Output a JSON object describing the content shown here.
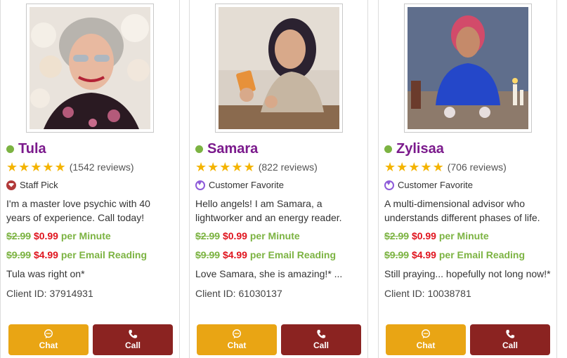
{
  "advisors": [
    {
      "name": "Tula",
      "rating": 5,
      "reviews": "(1542 reviews)",
      "badge": "Staff Pick",
      "badge_icon": "diamond-badge-icon",
      "bio": "I'm a master love psychic with 40 years of experience. Call today!",
      "minute_old": "$2.99",
      "minute_new": "$0.99",
      "minute_unit": "per Minute",
      "email_old": "$9.99",
      "email_new": "$4.99",
      "email_unit": "per Email Reading",
      "review_snippet": "Tula was right on*",
      "client_id": "Client ID: 37914931",
      "chat_label": "Chat",
      "call_label": "Call"
    },
    {
      "name": "Samara",
      "rating": 5,
      "reviews": "(822 reviews)",
      "badge": "Customer Favorite",
      "badge_icon": "heart-badge-icon",
      "bio": "Hello angels! I am Samara, a lightworker and an energy reader.",
      "minute_old": "$2.99",
      "minute_new": "$0.99",
      "minute_unit": "per Minute",
      "email_old": "$9.99",
      "email_new": "$4.99",
      "email_unit": "per Email Reading",
      "review_snippet": "Love Samara, she is amazing!* ...",
      "client_id": "Client ID: 61030137",
      "chat_label": "Chat",
      "call_label": "Call"
    },
    {
      "name": "Zylisaa",
      "rating": 5,
      "reviews": "(706 reviews)",
      "badge": "Customer Favorite",
      "badge_icon": "heart-badge-icon",
      "bio": "A multi-dimensional advisor who understands different phases of life.",
      "minute_old": "$2.99",
      "minute_new": "$0.99",
      "minute_unit": "per Minute",
      "email_old": "$9.99",
      "email_new": "$4.99",
      "email_unit": "per Email Reading",
      "review_snippet": "Still praying... hopefully not long now!*",
      "client_id": "Client ID: 10038781",
      "chat_label": "Chat",
      "call_label": "Call"
    }
  ],
  "colors": {
    "name": "#7b1a8c",
    "online": "#7cb342",
    "star": "#f4b400",
    "price_old": "#7cb342",
    "price_new": "#e0141e",
    "chat_button": "#e9a514",
    "call_button": "#8b2321"
  }
}
